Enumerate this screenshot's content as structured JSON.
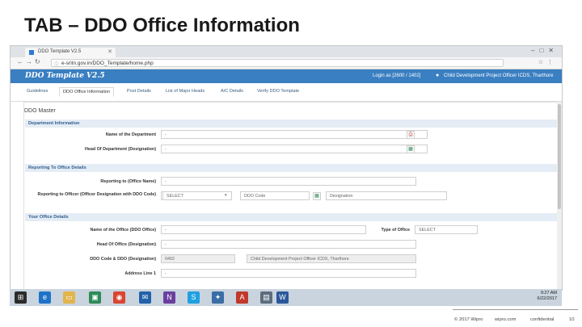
{
  "slide": {
    "title": "TAB – DDO Office Information",
    "footer": {
      "copyright": "© 2017 Wipro",
      "site": "wipro.com",
      "confidential": "confidential",
      "page": "10"
    }
  },
  "browser": {
    "tab_title": "DDO Template V2.5",
    "url": "e-sritn.gov.in/DDO_Template/home.php"
  },
  "app": {
    "logo": "DDO Template V2.5",
    "login_as": "Login as [2600 / 1402]",
    "user_role": "Child Development Project Officer ICDS, Tharthore",
    "header_color": "#3a7fc1"
  },
  "nav": {
    "tabs": [
      {
        "label": "Guidelines"
      },
      {
        "label": "DDO Office Information"
      },
      {
        "label": "Post Details"
      },
      {
        "label": "List of Major Heads"
      },
      {
        "label": "A/C Details"
      },
      {
        "label": "Verify DDO Template"
      }
    ],
    "active_index": 1
  },
  "form": {
    "panel_title": "DDO Master",
    "sections": {
      "department": "Department Information",
      "reporting": "Reporting To Office Details",
      "your_office": "Your Office Details"
    },
    "fields": {
      "dept_name": {
        "label": "Name of the Department",
        "value": "-"
      },
      "dept_head": {
        "label": "Head Of Department (Designation)",
        "value": "-"
      },
      "reporting_to": {
        "label": "Reporting to (Office Name)",
        "value": "-"
      },
      "reporting_officer": {
        "label": "Reporting to Officer (Officer Designation with DDO Code)",
        "select": "SELECT",
        "ddo_code_placeholder": "DDO Code",
        "designation_placeholder": "Designation"
      },
      "office_name": {
        "label": "Name of the Office (DDO Office)",
        "value": "-"
      },
      "type_of_office": {
        "label": "Type of Office",
        "select": "SELECT"
      },
      "head_of_office": {
        "label": "Head Of Office (Designation)",
        "value": "-"
      },
      "ddo_code": {
        "label": "DDO Code & DDO (Designation)",
        "code_value": "0402",
        "designation_value": "Child Development Project Officer ICDS, Tharthore"
      },
      "address_line_1": {
        "label": "Address Line 1",
        "value": "-"
      }
    }
  },
  "taskbar": {
    "time": "9:27 AM",
    "date": "6/22/2017"
  }
}
